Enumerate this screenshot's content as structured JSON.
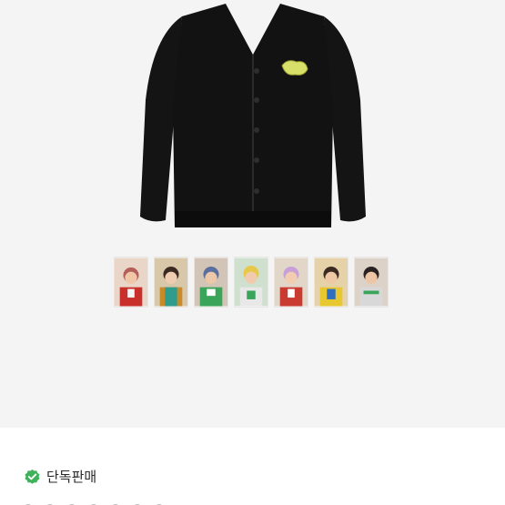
{
  "product": {
    "image_icon": "black-cardigan-image",
    "patch_color": "#d8e06a",
    "body_color": "#141414",
    "photocard_count": 7,
    "photocard_colors": [
      "#c9302c",
      "#c98a2a",
      "#3aa55a",
      "#e8e8e8",
      "#c93a30",
      "#e8c830",
      "#d8d8d8"
    ]
  },
  "badge": {
    "icon": "check-circle-icon",
    "icon_color": "#3fb15a",
    "label": "단독판매"
  }
}
